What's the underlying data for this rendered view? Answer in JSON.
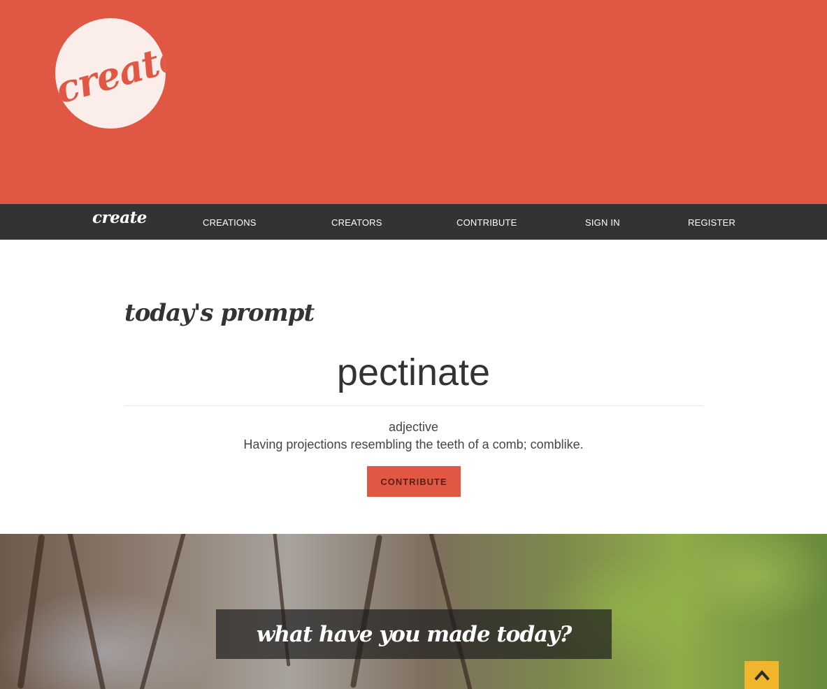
{
  "brand": {
    "logo_text": "create",
    "nav_brand": "create"
  },
  "nav": {
    "items": [
      {
        "label": "CREATIONS"
      },
      {
        "label": "CREATORS"
      },
      {
        "label": "CONTRIBUTE"
      },
      {
        "label": "SIGN IN"
      },
      {
        "label": "REGISTER"
      }
    ]
  },
  "prompt": {
    "heading": "today's prompt",
    "word": "pectinate",
    "part_of_speech": "adjective",
    "definition": "Having projections resembling the teeth of a comb; comblike.",
    "button_label": "CONTRIBUTE"
  },
  "feature": {
    "caption": "what have you made today?"
  },
  "back_to_top": {
    "icon": "chevron-up-icon"
  },
  "colors": {
    "accent": "#e05744",
    "nav_bg": "#333333",
    "back_to_top": "#f0b52d"
  }
}
